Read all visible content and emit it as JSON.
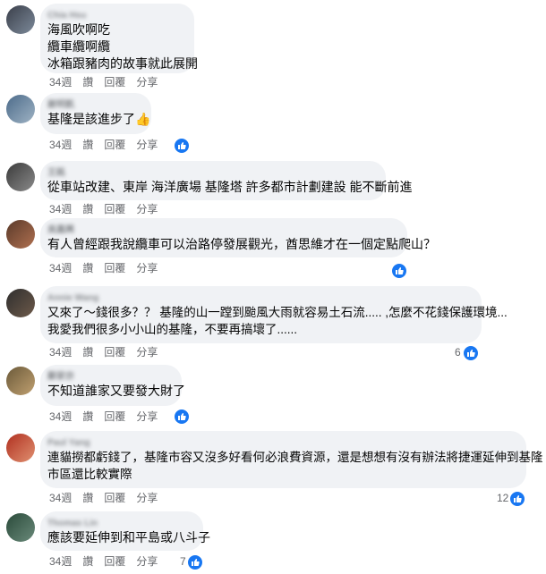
{
  "comments": [
    {
      "name": "Chia Hsu",
      "lines": [
        "海風吹啊吃",
        "纜車纜啊纜",
        "冰箱跟豬肉的故事就此展開"
      ],
      "time": "34週",
      "like": "讚",
      "reply": "回覆",
      "share": "分享",
      "avatar_colors": [
        "#3a3f4a",
        "#7d8a9a"
      ]
    },
    {
      "name": "謝明凱",
      "lines": [
        "基隆是該進步了👍"
      ],
      "time": "34週",
      "like": "讚",
      "reply": "回覆",
      "share": "分享",
      "avatar_colors": [
        "#4c6b8a",
        "#9fb3c4"
      ]
    },
    {
      "name": "王銘",
      "lines": [
        "從車站改建、東岸 海洋廣場 基隆塔 許多都市計劃建設 能不斷前進"
      ],
      "time": "34週",
      "like": "讚",
      "reply": "回覆",
      "share": "分享",
      "avatar_colors": [
        "#3b3b3b",
        "#8a8a8a"
      ]
    },
    {
      "name": "吳嘉興",
      "lines": [
        "有人曾經跟我說纜車可以治路停發展觀光，酋思維才在一個定點爬山？"
      ],
      "time": "34週",
      "like": "讚",
      "reply": "回覆",
      "share": "分享",
      "avatar_colors": [
        "#5a3a2a",
        "#b07050"
      ]
    },
    {
      "name": "Annie Wang",
      "lines": [
        "又來了～錢很多？？ 基隆的山一蹚到颱風大雨就容易土石流..... ,怎麼不花錢保護環境...",
        "我愛我們很多小小山的基隆，不要再搞壞了......"
      ],
      "time": "34週",
      "like": "讚",
      "reply": "回覆",
      "share": "分享",
      "reaction_count": "6",
      "avatar_colors": [
        "#2e2e2e",
        "#6e5a4a"
      ]
    },
    {
      "name": "鄭家亦",
      "lines": [
        "不知道誰家又要發大財了"
      ],
      "time": "34週",
      "like": "讚",
      "reply": "回覆",
      "share": "分享",
      "avatar_colors": [
        "#6b5a3a",
        "#c0a070"
      ]
    },
    {
      "name": "Paul Yang",
      "lines": [
        "連貓撈都虧錢了，基隆市容又沒多好看何必浪費資源，還是想想有沒有辦法將捷運延伸到基隆",
        "市區還比較實際"
      ],
      "time": "34週",
      "like": "讚",
      "reply": "回覆",
      "share": "分享",
      "reaction_count": "12",
      "avatar_colors": [
        "#b03020",
        "#e09070"
      ]
    },
    {
      "name": "Thomas Lin",
      "lines": [
        "應該要延伸到和平島或八斗子"
      ],
      "time": "34週",
      "like": "讚",
      "reply": "回覆",
      "share": "分享",
      "reaction_count": "7",
      "avatar_colors": [
        "#2a4a3a",
        "#6a8a7a"
      ]
    }
  ],
  "colors": {
    "like_blue": "#1877f2",
    "bubble_bg": "#f0f2f5",
    "meta_gray": "#65676b"
  }
}
